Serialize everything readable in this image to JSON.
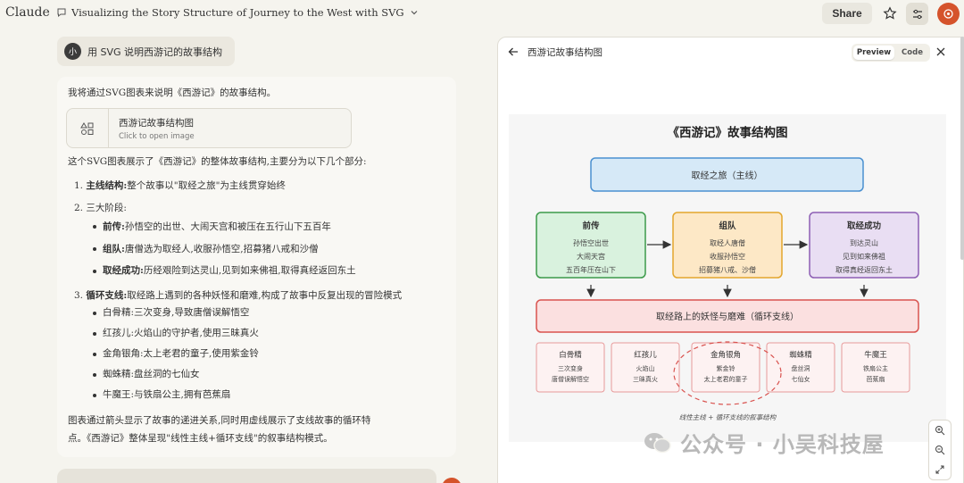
{
  "app": {
    "brand": "Claude"
  },
  "header": {
    "conversation_title": "Visualizing the Story Structure of Journey to the West with SVG",
    "share_label": "Share"
  },
  "user_message": {
    "avatar_initial": "小",
    "text": "用 SVG 说明西游记的故事结构"
  },
  "assistant": {
    "intro": "我将通过SVG图表来说明《西游记》的故事结构。",
    "artifact_card": {
      "title": "西游记故事结构图",
      "subtitle": "Click to open image"
    },
    "summary": "这个SVG图表展示了《西游记》的整体故事结构,主要分为以下几个部分:",
    "list": [
      {
        "num": "1.",
        "bold": "主线结构:",
        "text": "整个故事以\"取经之旅\"为主线贯穿始终"
      },
      {
        "num": "2.",
        "bold": "",
        "text": "三大阶段:"
      },
      {
        "num": "3.",
        "bold": "循环支线:",
        "text": "取经路上遇到的各种妖怪和磨难,构成了故事中反复出现的冒险模式"
      }
    ],
    "stages": [
      {
        "bold": "前传:",
        "text": "孙悟空的出世、大闹天宫和被压在五行山下五百年"
      },
      {
        "bold": "组队:",
        "text": "唐僧选为取经人,收服孙悟空,招募猪八戒和沙僧"
      },
      {
        "bold": "取经成功:",
        "text": "历经艰险到达灵山,见到如来佛祖,取得真经返回东土"
      }
    ],
    "monsters": [
      "白骨精:三次变身,导致唐僧误解悟空",
      "红孩儿:火焰山的守护者,使用三昧真火",
      "金角银角:太上老君的童子,使用紫金铃",
      "蜘蛛精:盘丝洞的七仙女",
      "牛魔王:与铁扇公主,拥有芭蕉扇"
    ],
    "conclusion_1": "图表通过箭头显示了故事的递进关系,同时用虚线展示了支线故事的循环特",
    "conclusion_2": "点。《西游记》整体呈现\"线性主线+循环支线\"的叙事结构模式。"
  },
  "artifact_panel": {
    "title": "西游记故事结构图",
    "preview_label": "Preview",
    "code_label": "Code"
  },
  "diagram": {
    "title": "《西游记》故事结构图",
    "main_line": "取经之旅（主线）",
    "stages": [
      {
        "title": "前传",
        "lines": [
          "孙悟空出世",
          "大闹天宫",
          "五百年压在山下"
        ],
        "fill": "#d9f2de",
        "stroke": "#3c9a4a"
      },
      {
        "title": "组队",
        "lines": [
          "取经人唐僧",
          "收服孙悟空",
          "招募猪八戒、沙僧"
        ],
        "fill": "#fde8c6",
        "stroke": "#e3a62d"
      },
      {
        "title": "取经成功",
        "lines": [
          "到达灵山",
          "见到如来佛祖",
          "取得真经返回东土"
        ],
        "fill": "#e9def3",
        "stroke": "#8d5fb4"
      }
    ],
    "branch": "取经路上的妖怪与磨难（循环支线）",
    "monsters": [
      {
        "title": "白骨精",
        "lines": [
          "三次变身",
          "唐僧误解悟空"
        ]
      },
      {
        "title": "红孩儿",
        "lines": [
          "火焰山",
          "三昧真火"
        ]
      },
      {
        "title": "金角银角",
        "lines": [
          "紫金铃",
          "太上老君的童子"
        ]
      },
      {
        "title": "蜘蛛精",
        "lines": [
          "盘丝洞",
          "七仙女"
        ]
      },
      {
        "title": "牛魔王",
        "lines": [
          "铁扇公主",
          "芭蕉扇"
        ]
      }
    ],
    "caption": "线性主线 + 循环支线的叙事结构",
    "colors": {
      "main_fill": "#d6e9f7",
      "main_stroke": "#4a90d0",
      "branch_fill": "#fbe0e0",
      "branch_stroke": "#d9534f",
      "monster_fill": "#fdf2f2",
      "monster_stroke": "#e79a9a",
      "dashed": "#d9534f"
    }
  },
  "watermark": {
    "text": "公众号 · 小吴科技屋"
  },
  "icons": [
    "chat-bubble-icon",
    "chevron-down-icon",
    "star-icon",
    "tune-icon",
    "shapes-icon",
    "back-arrow-icon",
    "close-icon",
    "zoom-in-icon",
    "zoom-out-icon",
    "expand-icon"
  ]
}
